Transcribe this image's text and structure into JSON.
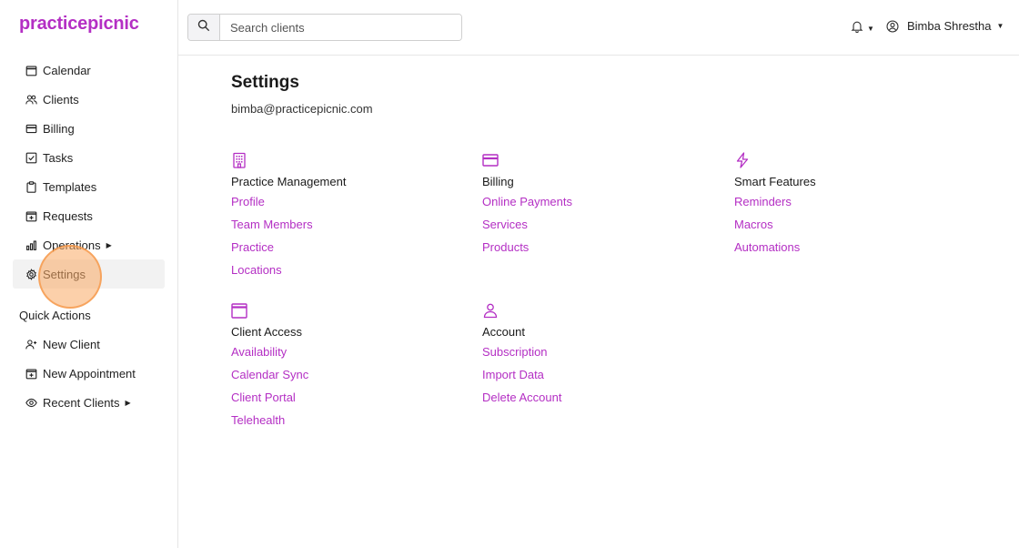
{
  "brand": {
    "name": "practicepicnic",
    "color": "#b42fc4"
  },
  "accent": "#b42fc4",
  "sidebar": {
    "items": [
      {
        "label": "Calendar",
        "icon": "calendar-icon"
      },
      {
        "label": "Clients",
        "icon": "users-icon"
      },
      {
        "label": "Billing",
        "icon": "credit-card-icon"
      },
      {
        "label": "Tasks",
        "icon": "checkbox-icon"
      },
      {
        "label": "Templates",
        "icon": "clipboard-icon"
      },
      {
        "label": "Requests",
        "icon": "calendar-plus-icon"
      },
      {
        "label": "Operations",
        "icon": "bar-chart-icon"
      },
      {
        "label": "Settings",
        "icon": "gear-icon"
      }
    ],
    "quick_actions_title": "Quick Actions",
    "quick_actions": [
      {
        "label": "New Client",
        "icon": "user-plus-icon"
      },
      {
        "label": "New Appointment",
        "icon": "calendar-plus-icon"
      },
      {
        "label": "Recent Clients",
        "icon": "eye-icon"
      }
    ]
  },
  "topbar": {
    "search_placeholder": "Search clients",
    "user_name": "Bimba Shrestha"
  },
  "page": {
    "title": "Settings",
    "email": "bimba@practicepicnic.com",
    "sections": [
      {
        "title": "Practice Management",
        "icon": "building-icon",
        "links": [
          "Profile",
          "Team Members",
          "Practice",
          "Locations"
        ]
      },
      {
        "title": "Billing",
        "icon": "credit-card-icon",
        "links": [
          "Online Payments",
          "Services",
          "Products"
        ]
      },
      {
        "title": "Smart Features",
        "icon": "lightning-icon",
        "links": [
          "Reminders",
          "Macros",
          "Automations"
        ]
      },
      {
        "title": "Client Access",
        "icon": "calendar-icon",
        "links": [
          "Availability",
          "Calendar Sync",
          "Client Portal",
          "Telehealth"
        ]
      },
      {
        "title": "Account",
        "icon": "person-icon",
        "links": [
          "Subscription",
          "Import Data",
          "Delete Account"
        ]
      }
    ]
  }
}
